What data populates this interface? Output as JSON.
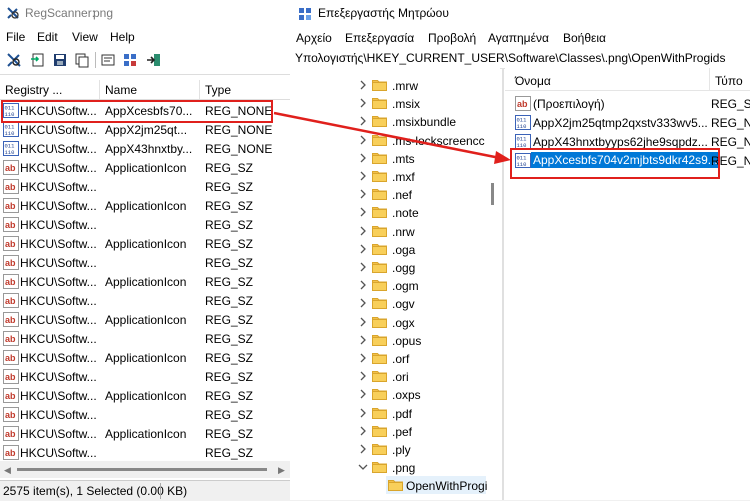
{
  "regscanner": {
    "title": "RegScanner:",
    "title_ext": "png",
    "menu": [
      "File",
      "Edit",
      "View",
      "Help"
    ],
    "columns": [
      "Registry ...",
      "Name",
      "Type"
    ],
    "rows": [
      {
        "key": "HKCU\\Softw...",
        "name": "AppXcesbfs70...",
        "type": "REG_NONE",
        "icon": "binary-value-icon"
      },
      {
        "key": "HKCU\\Softw...",
        "name": "AppX2jm25qt...",
        "type": "REG_NONE",
        "icon": "binary-value-icon"
      },
      {
        "key": "HKCU\\Softw...",
        "name": "AppX43hnxtby...",
        "type": "REG_NONE",
        "icon": "binary-value-icon"
      },
      {
        "key": "HKCU\\Softw...",
        "name": "ApplicationIcon",
        "type": "REG_SZ",
        "icon": "string-value-icon"
      },
      {
        "key": "HKCU\\Softw...",
        "name": "",
        "type": "REG_SZ",
        "icon": "string-value-icon"
      },
      {
        "key": "HKCU\\Softw...",
        "name": "ApplicationIcon",
        "type": "REG_SZ",
        "icon": "string-value-icon"
      },
      {
        "key": "HKCU\\Softw...",
        "name": "",
        "type": "REG_SZ",
        "icon": "string-value-icon"
      },
      {
        "key": "HKCU\\Softw...",
        "name": "ApplicationIcon",
        "type": "REG_SZ",
        "icon": "string-value-icon"
      },
      {
        "key": "HKCU\\Softw...",
        "name": "",
        "type": "REG_SZ",
        "icon": "string-value-icon"
      },
      {
        "key": "HKCU\\Softw...",
        "name": "ApplicationIcon",
        "type": "REG_SZ",
        "icon": "string-value-icon"
      },
      {
        "key": "HKCU\\Softw...",
        "name": "",
        "type": "REG_SZ",
        "icon": "string-value-icon"
      },
      {
        "key": "HKCU\\Softw...",
        "name": "ApplicationIcon",
        "type": "REG_SZ",
        "icon": "string-value-icon"
      },
      {
        "key": "HKCU\\Softw...",
        "name": "",
        "type": "REG_SZ",
        "icon": "string-value-icon"
      },
      {
        "key": "HKCU\\Softw...",
        "name": "ApplicationIcon",
        "type": "REG_SZ",
        "icon": "string-value-icon"
      },
      {
        "key": "HKCU\\Softw...",
        "name": "",
        "type": "REG_SZ",
        "icon": "string-value-icon"
      },
      {
        "key": "HKCU\\Softw...",
        "name": "ApplicationIcon",
        "type": "REG_SZ",
        "icon": "string-value-icon"
      },
      {
        "key": "HKCU\\Softw...",
        "name": "",
        "type": "REG_SZ",
        "icon": "string-value-icon"
      },
      {
        "key": "HKCU\\Softw...",
        "name": "ApplicationIcon",
        "type": "REG_SZ",
        "icon": "string-value-icon"
      },
      {
        "key": "HKCU\\Softw...",
        "name": "",
        "type": "REG_SZ",
        "icon": "string-value-icon"
      }
    ],
    "status": "2575 item(s), 1 Selected  (0.00 KB)"
  },
  "regedit": {
    "title": "Επεξεργαστής Μητρώου",
    "menu": [
      "Αρχείο",
      "Επεξεργασία",
      "Προβολή",
      "Αγαπημένα",
      "Βοήθεια"
    ],
    "address": "Υπολογιστής\\HKEY_CURRENT_USER\\Software\\Classes\\.png\\OpenWithProgids",
    "tree": [
      {
        "label": ".mrw",
        "expanded": false
      },
      {
        "label": ".msix",
        "expanded": false
      },
      {
        "label": ".msixbundle",
        "expanded": false
      },
      {
        "label": ".ms-lockscreencc",
        "expanded": false
      },
      {
        "label": ".mts",
        "expanded": false
      },
      {
        "label": ".mxf",
        "expanded": false
      },
      {
        "label": ".nef",
        "expanded": false
      },
      {
        "label": ".note",
        "expanded": false
      },
      {
        "label": ".nrw",
        "expanded": false
      },
      {
        "label": ".oga",
        "expanded": false
      },
      {
        "label": ".ogg",
        "expanded": false
      },
      {
        "label": ".ogm",
        "expanded": false
      },
      {
        "label": ".ogv",
        "expanded": false
      },
      {
        "label": ".ogx",
        "expanded": false
      },
      {
        "label": ".opus",
        "expanded": false
      },
      {
        "label": ".orf",
        "expanded": false
      },
      {
        "label": ".ori",
        "expanded": false
      },
      {
        "label": ".oxps",
        "expanded": false
      },
      {
        "label": ".pdf",
        "expanded": false
      },
      {
        "label": ".pef",
        "expanded": false
      },
      {
        "label": ".ply",
        "expanded": false
      },
      {
        "label": ".png",
        "expanded": true
      },
      {
        "label": "OpenWithProgi",
        "child": true
      }
    ],
    "columns": [
      "Όνομα",
      "Τύπο"
    ],
    "values": [
      {
        "name": "(Προεπιλογή)",
        "type": "REG_S",
        "icon": "string-value-icon"
      },
      {
        "name": "AppX2jm25qtmp2qxstv333wv5...",
        "type": "REG_N",
        "icon": "binary-value-icon"
      },
      {
        "name": "AppX43hnxtbyyps62jhe9sqpdz...",
        "type": "REG_N",
        "icon": "binary-value-icon"
      },
      {
        "name": "AppXcesbfs704v2mjbts9dkr42s9...",
        "type": "REG_N",
        "icon": "binary-value-icon",
        "selected": true
      }
    ],
    "colors": {
      "selection": "#0078d7",
      "annotation": "#e0201c",
      "folder": "#f3c04a"
    }
  }
}
